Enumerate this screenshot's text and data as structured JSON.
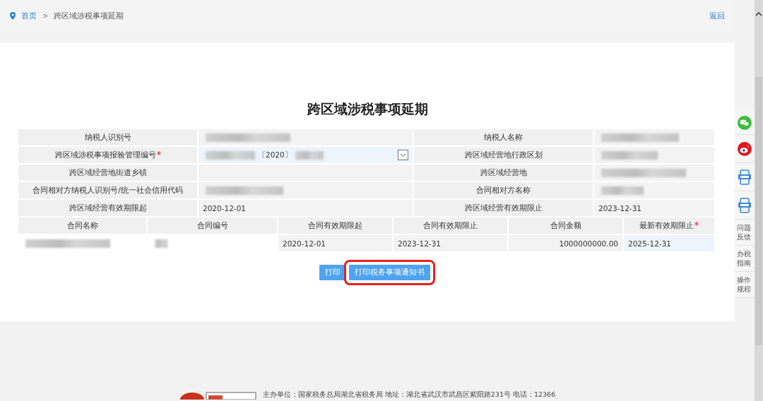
{
  "breadcrumb": {
    "home": "首页",
    "separator": ">",
    "current": "跨区域涉税事项延期",
    "back": "返回"
  },
  "title": "跨区域涉税事项延期",
  "form": {
    "rows": [
      [
        {
          "label": "纳税人识别号",
          "required": false,
          "kind": "redacted"
        },
        {
          "label": "纳税人名称",
          "required": false,
          "kind": "redacted"
        }
      ],
      [
        {
          "label": "跨区域涉税事项报验管理编号",
          "required": true,
          "kind": "select",
          "value": "〔2020〕"
        },
        {
          "label": "跨区域经营地行政区划",
          "required": false,
          "kind": "redacted"
        }
      ],
      [
        {
          "label": "跨区域经营地街道乡镇",
          "required": false,
          "kind": "empty"
        },
        {
          "label": "跨区域经营地",
          "required": false,
          "kind": "redacted"
        }
      ],
      [
        {
          "label": "合同相对方纳税人识别号/统一社会信用代码",
          "required": false,
          "kind": "redacted"
        },
        {
          "label": "合同相对方名称",
          "required": false,
          "kind": "redacted"
        }
      ],
      [
        {
          "label": "跨区域经营有效期限起",
          "required": false,
          "kind": "text",
          "value": "2020-12-01"
        },
        {
          "label": "跨区域经营有效期限止",
          "required": false,
          "kind": "text",
          "value": "2023-12-31"
        }
      ]
    ]
  },
  "contracts": {
    "columns": [
      {
        "label": "合同名称",
        "required": false
      },
      {
        "label": "合同编号",
        "required": false
      },
      {
        "label": "合同有效期限起",
        "required": false
      },
      {
        "label": "合同有效期限止",
        "required": false
      },
      {
        "label": "合同金额",
        "required": false
      },
      {
        "label": "最新有效期限止",
        "required": true
      }
    ],
    "rows": [
      [
        {
          "kind": "redacted"
        },
        {
          "kind": "redacted"
        },
        {
          "kind": "text",
          "value": "2020-12-01"
        },
        {
          "kind": "text",
          "value": "2023-12-31"
        },
        {
          "kind": "amount",
          "value": "1000000000.00"
        },
        {
          "kind": "input",
          "value": "2025-12-31"
        }
      ]
    ]
  },
  "buttons": [
    {
      "label": "打印",
      "highlighted": false
    },
    {
      "label": "打印税务事项通知书",
      "highlighted": true
    }
  ],
  "side_tools": [
    {
      "kind": "wechat"
    },
    {
      "kind": "weibo"
    },
    {
      "kind": "app"
    },
    {
      "kind": "app"
    },
    {
      "kind": "text",
      "label": "问题反馈"
    },
    {
      "kind": "text",
      "label": "办税指南"
    },
    {
      "kind": "text",
      "label": "操作规程"
    }
  ],
  "footer": {
    "text": "主办单位：国家税务总局湖北省税务局  地址：湖北省武汉市武昌区紫阳路231号  电话：12366"
  }
}
